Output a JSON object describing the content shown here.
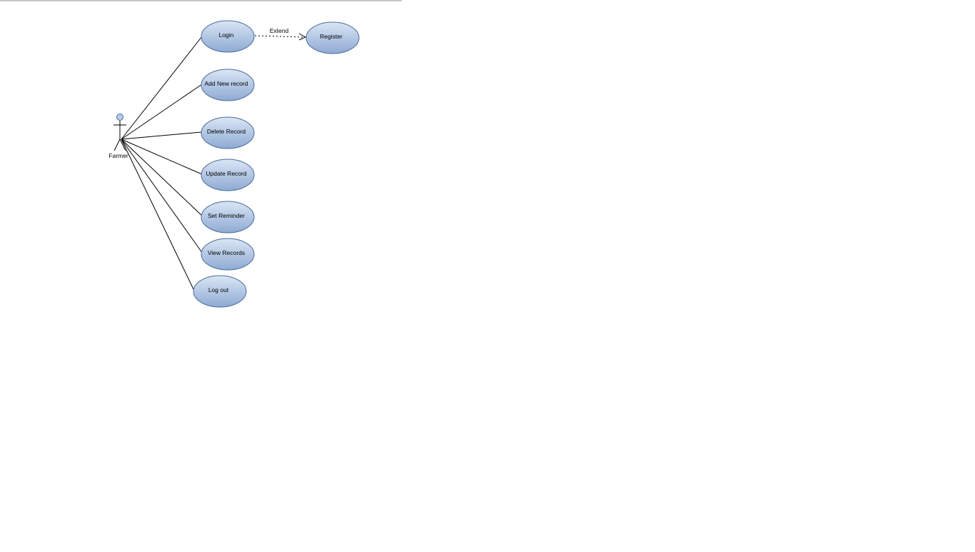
{
  "diagram": {
    "type": "use-case",
    "actor": {
      "name": "Farmer"
    },
    "use_cases": [
      {
        "id": "login",
        "label": "Login"
      },
      {
        "id": "register",
        "label": "Register"
      },
      {
        "id": "add-new-record",
        "label": "Add New record"
      },
      {
        "id": "delete-record",
        "label": "Delete Record"
      },
      {
        "id": "update-record",
        "label": "Update Record"
      },
      {
        "id": "set-reminder",
        "label": "Set Reminder"
      },
      {
        "id": "view-records",
        "label": "View Records"
      },
      {
        "id": "log-out",
        "label": "Log out"
      }
    ],
    "associations": [
      {
        "from": "Farmer",
        "to": "login"
      },
      {
        "from": "Farmer",
        "to": "add-new-record"
      },
      {
        "from": "Farmer",
        "to": "delete-record"
      },
      {
        "from": "Farmer",
        "to": "update-record"
      },
      {
        "from": "Farmer",
        "to": "set-reminder"
      },
      {
        "from": "Farmer",
        "to": "view-records"
      },
      {
        "from": "Farmer",
        "to": "log-out"
      }
    ],
    "relationships": [
      {
        "from": "login",
        "to": "register",
        "label": "Extend",
        "style": "dashed-arrow"
      }
    ],
    "colors": {
      "usecase_fill_top": "#dae6f5",
      "usecase_fill_bottom": "#8eaad3",
      "usecase_stroke": "#4a6b9a",
      "actor_fill": "#b8cbe6",
      "line": "#000000"
    }
  }
}
